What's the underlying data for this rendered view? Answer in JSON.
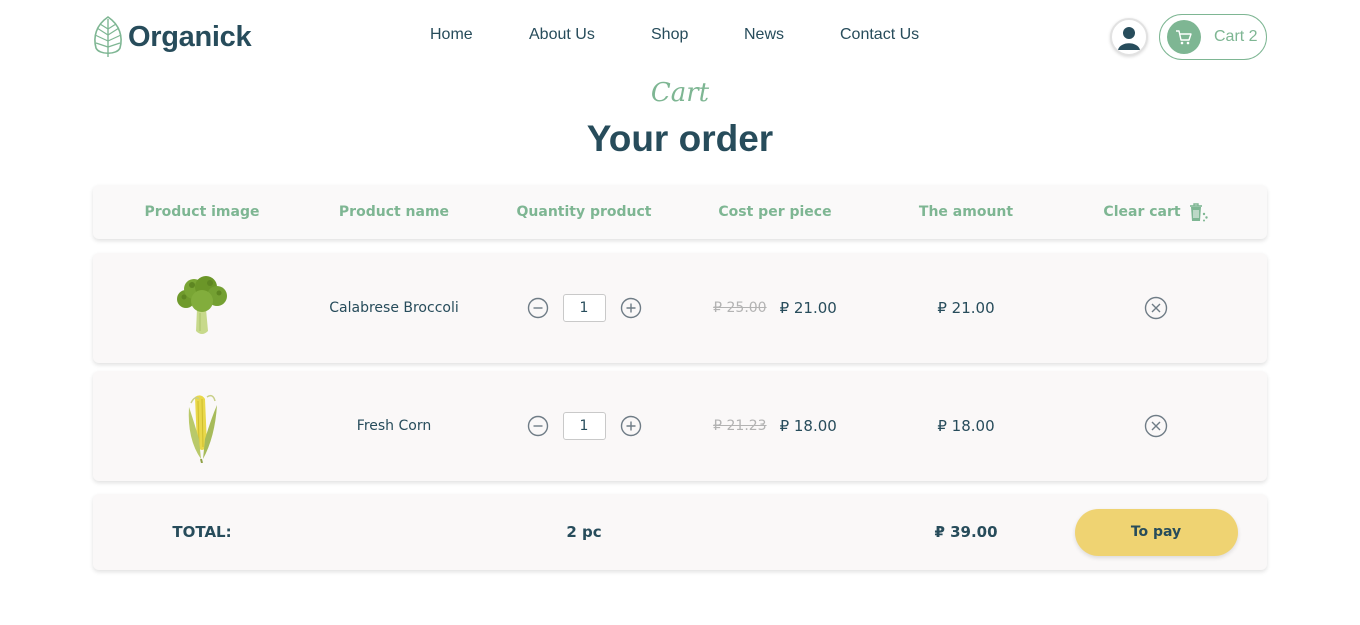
{
  "brand": {
    "name": "Organick"
  },
  "nav": {
    "items": [
      "Home",
      "About Us",
      "Shop",
      "News",
      "Contact Us"
    ]
  },
  "cart_button": {
    "label": "Cart 2"
  },
  "page": {
    "subtitle": "Cart",
    "title": "Your order"
  },
  "table": {
    "headers": [
      "Product image",
      "Product name",
      "Quantity product",
      "Cost per piece",
      "The amount",
      "Clear cart"
    ],
    "rows": [
      {
        "image": "broccoli",
        "name": "Calabrese Broccoli",
        "quantity": "1",
        "old_price": "₽ 25.00",
        "price": "₽ 21.00",
        "amount": "₽ 21.00"
      },
      {
        "image": "corn",
        "name": "Fresh Corn",
        "quantity": "1",
        "old_price": "₽ 21.23",
        "price": "₽ 18.00",
        "amount": "₽ 18.00"
      }
    ],
    "total": {
      "label": "TOTAL:",
      "count": "2 pc",
      "amount": "₽ 39.00",
      "pay_label": "To pay"
    }
  },
  "icons": {
    "logo": "leaf-logo-icon",
    "avatar": "user-icon",
    "cart": "shopping-cart-icon",
    "clear": "trash-icon",
    "minus": "minus-circle-icon",
    "plus": "plus-circle-icon",
    "remove": "close-circle-icon"
  },
  "colors": {
    "primary": "#274c5b",
    "accent": "#7eb693",
    "button": "#efd372",
    "muted": "#b3b3b3"
  }
}
